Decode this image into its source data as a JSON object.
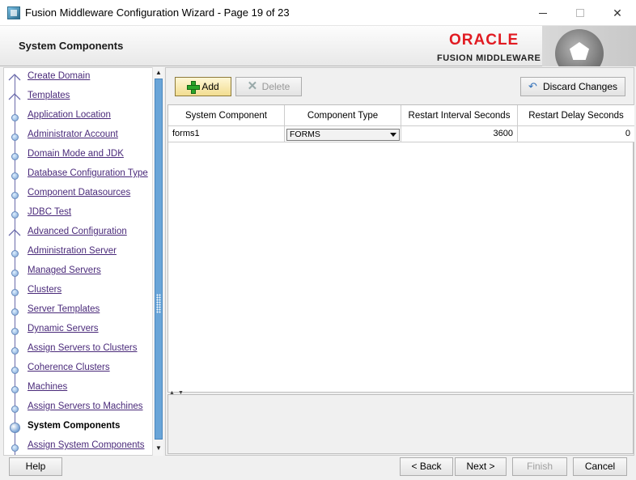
{
  "window": {
    "title": "Fusion Middleware Configuration Wizard - Page 19 of 23"
  },
  "header": {
    "page_title": "System Components",
    "logo_word": "ORACLE",
    "logo_sub": "FUSION MIDDLEWARE"
  },
  "nav": {
    "items": [
      {
        "label": "Create Domain",
        "state": "done-chevron"
      },
      {
        "label": "Templates",
        "state": "done-chevron"
      },
      {
        "label": "Application Location",
        "state": "done"
      },
      {
        "label": "Administrator Account",
        "state": "done"
      },
      {
        "label": "Domain Mode and JDK",
        "state": "done"
      },
      {
        "label": "Database Configuration Type",
        "state": "done"
      },
      {
        "label": "Component Datasources",
        "state": "done"
      },
      {
        "label": "JDBC Test",
        "state": "done"
      },
      {
        "label": "Advanced Configuration",
        "state": "done-chevron"
      },
      {
        "label": "Administration Server",
        "state": "done"
      },
      {
        "label": "Managed Servers",
        "state": "done"
      },
      {
        "label": "Clusters",
        "state": "done"
      },
      {
        "label": "Server Templates",
        "state": "done"
      },
      {
        "label": "Dynamic Servers",
        "state": "done"
      },
      {
        "label": "Assign Servers to Clusters",
        "state": "done"
      },
      {
        "label": "Coherence Clusters",
        "state": "done"
      },
      {
        "label": "Machines",
        "state": "done"
      },
      {
        "label": "Assign Servers to Machines",
        "state": "done"
      },
      {
        "label": "System Components",
        "state": "current"
      },
      {
        "label": "Assign System Components",
        "state": "todo"
      }
    ]
  },
  "toolbar": {
    "add_label": "Add",
    "delete_label": "Delete",
    "discard_label": "Discard Changes"
  },
  "table": {
    "columns": [
      "System Component",
      "Component Type",
      "Restart Interval Seconds",
      "Restart Delay Seconds"
    ],
    "rows": [
      {
        "component": "forms1",
        "type": "FORMS",
        "interval": "3600",
        "delay": "0"
      }
    ]
  },
  "footer": {
    "help": "Help",
    "back": "< Back",
    "next": "Next >",
    "finish": "Finish",
    "cancel": "Cancel"
  },
  "colors": {
    "oracle_red": "#e11b22",
    "link": "#4a2a7a",
    "scroll_thumb": "#6aa5d8"
  }
}
